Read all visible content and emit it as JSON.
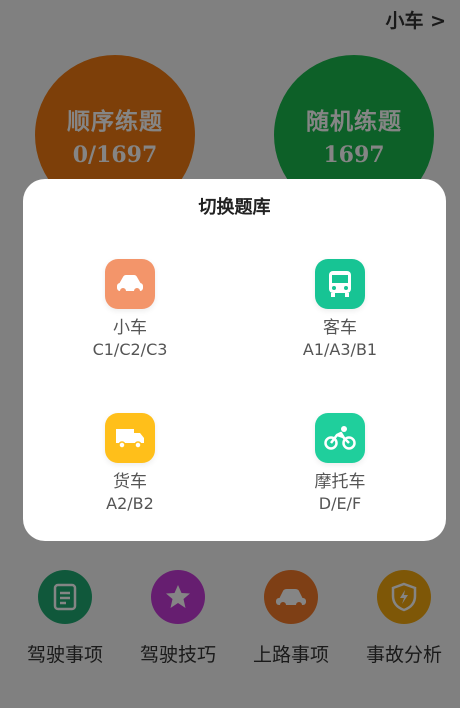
{
  "header": {
    "vehicle_switch": "小车 >"
  },
  "practice": {
    "sequential": {
      "label": "顺序练题",
      "count": "0/1697"
    },
    "random": {
      "label": "随机练题",
      "count": "1697"
    }
  },
  "bottom_nav": [
    {
      "label": "驾驶事项",
      "icon": "document-icon",
      "color": "#1fa971"
    },
    {
      "label": "驾驶技巧",
      "icon": "star-icon",
      "color": "#c43ad6"
    },
    {
      "label": "上路事项",
      "icon": "car-icon",
      "color": "#f2792a"
    },
    {
      "label": "事故分析",
      "icon": "shield-icon",
      "color": "#f1a70f"
    }
  ],
  "dialog": {
    "title": "切换题库",
    "options": [
      {
        "name": "小车",
        "classes": "C1/C2/C3",
        "icon": "car-icon",
        "color": "#f3956a"
      },
      {
        "name": "客车",
        "classes": "A1/A3/B1",
        "icon": "bus-icon",
        "color": "#17c494"
      },
      {
        "name": "货车",
        "classes": "A2/B2",
        "icon": "truck-icon",
        "color": "#ffbf1a"
      },
      {
        "name": "摩托车",
        "classes": "D/E/F",
        "icon": "bicycle-icon",
        "color": "#1fcf9c"
      }
    ]
  }
}
